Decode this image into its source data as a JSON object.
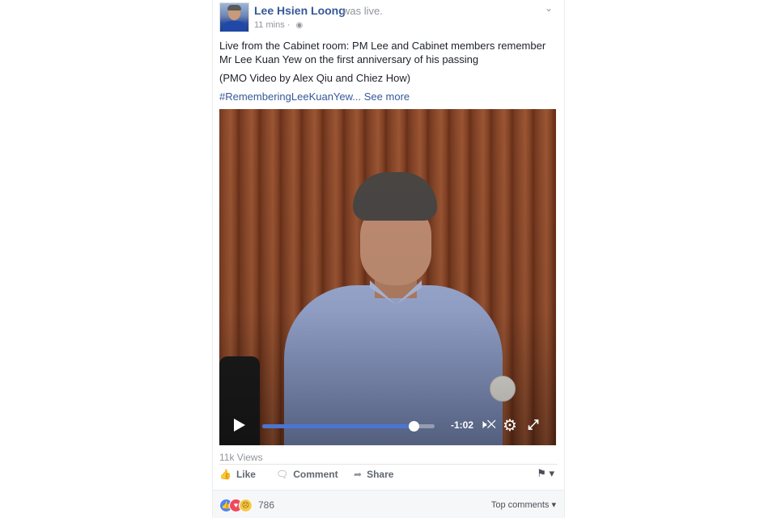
{
  "post": {
    "author": "Lee Hsien Loong",
    "status": "was live.",
    "time": "11 mins",
    "separator": "·",
    "audience_icon": "globe-icon",
    "menu_icon": "chevron-down-icon",
    "text_line1": "Live from the Cabinet room: PM Lee and Cabinet members remember Mr Lee Kuan Yew on the first anniversary of his passing",
    "text_line2": "(PMO Video by Alex Qiu and Chiez How)",
    "hashtag": "#RememberingLeeKuanYew...",
    "see_more": "See more"
  },
  "video": {
    "time_remaining": "-1:02",
    "progress_percent": 88,
    "controls": [
      "play-icon",
      "mute-icon",
      "gear-icon",
      "fullscreen-icon"
    ],
    "accent_color": "#4a76d1"
  },
  "stats": {
    "views": "11k Views"
  },
  "actions": {
    "like": "Like",
    "comment": "Comment",
    "share": "Share"
  },
  "reactions": {
    "count": "786",
    "types": [
      "like",
      "love",
      "sad"
    ],
    "sort_label": "Top comments"
  },
  "colors": {
    "link": "#365899",
    "meta": "#90949c"
  }
}
